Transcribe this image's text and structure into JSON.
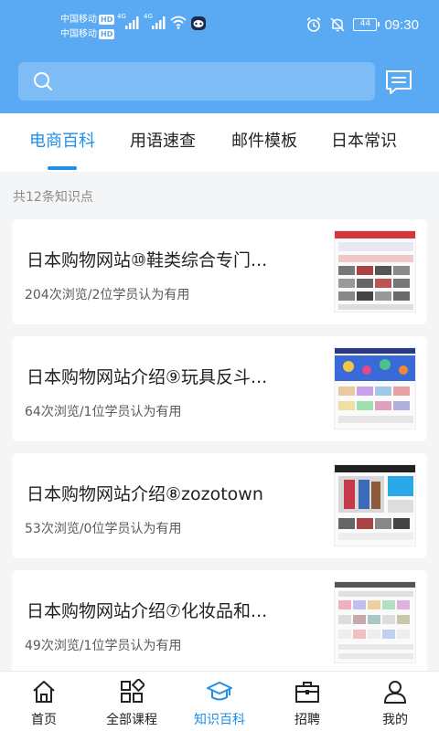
{
  "status_bar": {
    "carrier1": "中国移动",
    "carrier2": "中国移动",
    "hd": "HD",
    "net1": "4G",
    "net2": "4G",
    "battery": "44",
    "time": "09:30"
  },
  "search": {
    "placeholder": ""
  },
  "tabs": [
    {
      "label": "电商百科",
      "active": true
    },
    {
      "label": "用语速查",
      "active": false
    },
    {
      "label": "邮件模板",
      "active": false
    },
    {
      "label": "日本常识",
      "active": false
    }
  ],
  "count_text": "共12条知识点",
  "articles": [
    {
      "title": "日本购物网站⑩鞋类综合专门...",
      "meta": "204次浏览/2位学员认为有用"
    },
    {
      "title": "日本购物网站介绍⑨玩具反斗...",
      "meta": "64次浏览/1位学员认为有用"
    },
    {
      "title": "日本购物网站介绍⑧zozotown",
      "meta": "53次浏览/0位学员认为有用"
    },
    {
      "title": "日本购物网站介绍⑦化妆品和...",
      "meta": "49次浏览/1位学员认为有用"
    }
  ],
  "bottom_nav": [
    {
      "label": "首页",
      "icon": "home-icon",
      "active": false
    },
    {
      "label": "全部课程",
      "icon": "grid-icon",
      "active": false
    },
    {
      "label": "知识百科",
      "icon": "graduation-cap-icon",
      "active": true
    },
    {
      "label": "招聘",
      "icon": "briefcase-icon",
      "active": false
    },
    {
      "label": "我的",
      "icon": "user-icon",
      "active": false
    }
  ],
  "colors": {
    "header": "#5aa9f3",
    "accent": "#1e8fe8",
    "background": "#f4f5f7"
  }
}
